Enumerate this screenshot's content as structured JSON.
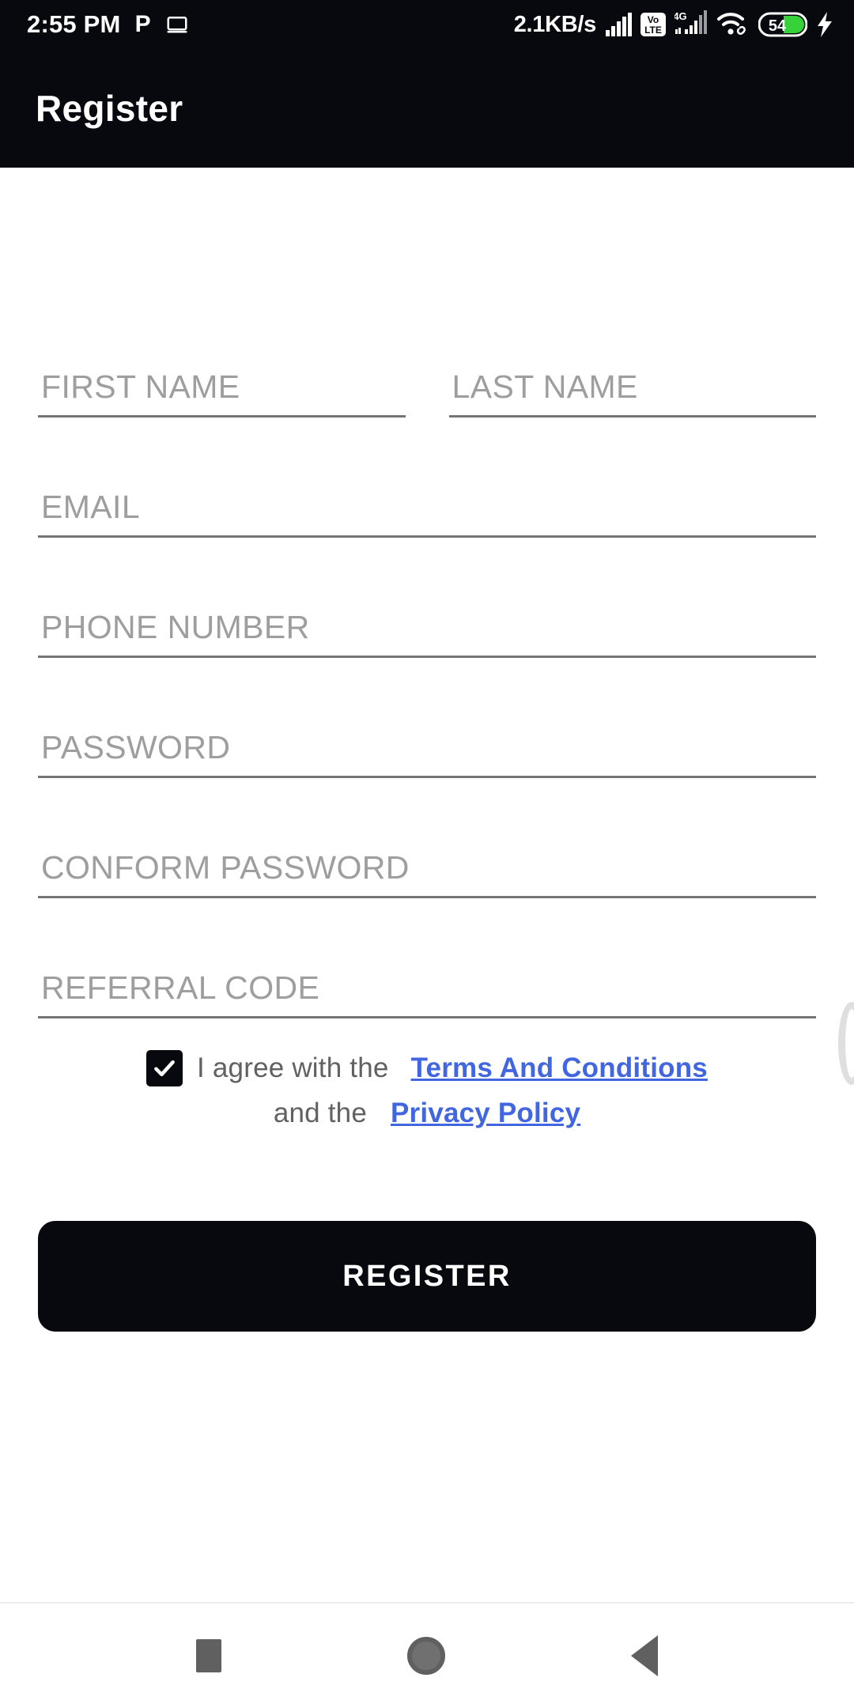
{
  "status_bar": {
    "clock": "2:55 PM",
    "network_speed": "2.1KB/s",
    "volte_top": "Vo",
    "volte_bottom": "LTE",
    "network_type": "4G",
    "battery_level": "54",
    "icons": [
      "pinterest-icon",
      "tablet-icon",
      "signal-bars-icon",
      "volte-icon",
      "network-4g-icon",
      "wifi-icon",
      "battery-icon",
      "charging-bolt-icon"
    ],
    "battery_color": "#35d23a"
  },
  "app_bar": {
    "title": "Register"
  },
  "form": {
    "first_name": {
      "placeholder": "FIRST NAME",
      "value": ""
    },
    "last_name": {
      "placeholder": "LAST NAME",
      "value": ""
    },
    "email": {
      "placeholder": "EMAIL",
      "value": ""
    },
    "phone": {
      "placeholder": "PHONE NUMBER",
      "value": ""
    },
    "password": {
      "placeholder": "PASSWORD",
      "value": ""
    },
    "confirm_password": {
      "placeholder": "CONFORM PASSWORD",
      "value": ""
    },
    "referral_code": {
      "placeholder": "REFERRAL CODE",
      "value": ""
    }
  },
  "terms": {
    "checked": true,
    "line1_prefix": "I agree with the",
    "line1_link": "Terms And Conditions",
    "line2_prefix": "and the",
    "line2_link": "Privacy Policy",
    "link_color": "#4166e0"
  },
  "actions": {
    "register_label": "REGISTER"
  },
  "nav_bar": {
    "recents": "recents-square-icon",
    "home": "home-circle-icon",
    "back": "back-triangle-icon"
  },
  "colors": {
    "app_bar_bg": "#08080f",
    "page_bg": "#ffffff",
    "placeholder": "#9e9e9e",
    "underline": "#757575"
  }
}
